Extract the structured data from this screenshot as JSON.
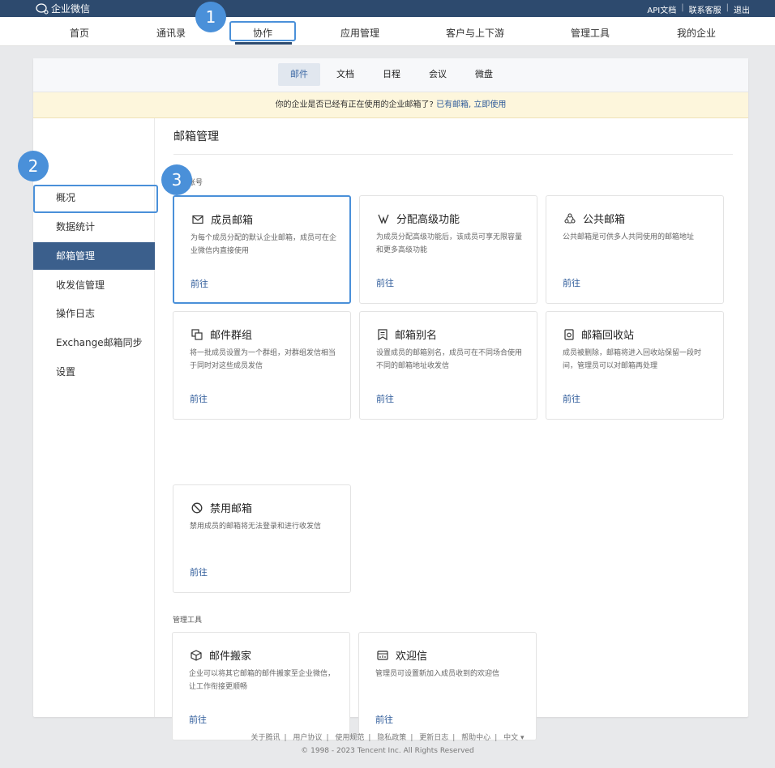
{
  "topbar": {
    "logo_text": "企业微信",
    "links": [
      "API文档",
      "联系客服",
      "退出"
    ]
  },
  "mainnav": {
    "items": [
      "首页",
      "通讯录",
      "协作",
      "应用管理",
      "客户与上下游",
      "管理工具",
      "我的企业"
    ],
    "active": "协作"
  },
  "badges": [
    "1",
    "2",
    "3"
  ],
  "subnav": {
    "tabs": [
      "邮件",
      "文档",
      "日程",
      "会议",
      "微盘"
    ],
    "active": "邮件"
  },
  "notice": {
    "text": "你的企业是否已经有正在使用的企业邮箱了?",
    "link": "已有邮箱, 立即使用"
  },
  "sidebar": {
    "items": [
      "概况",
      "数据统计",
      "邮箱管理",
      "收发信管理",
      "操作日志",
      "Exchange邮箱同步",
      "设置"
    ],
    "active": "邮箱管理"
  },
  "content": {
    "title": "邮箱管理",
    "section1_label": "账号",
    "section2_label": "管理工具",
    "go_label": "前往",
    "cards": [
      {
        "title": "成员邮箱",
        "desc": "为每个成员分配的默认企业邮箱，成员可在企业微信内直接使用",
        "icon": "mail-icon"
      },
      {
        "title": "分配高级功能",
        "desc": "为成员分配高级功能后，该成员可享无限容量和更多高级功能",
        "icon": "vip-icon"
      },
      {
        "title": "公共邮箱",
        "desc": "公共邮箱是可供多人共同使用的邮箱地址",
        "icon": "shared-icon"
      },
      {
        "title": "邮件群组",
        "desc": "将一批成员设置为一个群组，对群组发信相当于同时对这些成员发信",
        "icon": "group-icon"
      },
      {
        "title": "邮箱别名",
        "desc": "设置成员的邮箱别名，成员可在不同场合使用不同的邮箱地址收发信",
        "icon": "alias-icon"
      },
      {
        "title": "邮箱回收站",
        "desc": "成员被删除，邮箱将进入回收站保留一段时间，管理员可以对邮箱再处理",
        "icon": "recycle-icon"
      },
      {
        "title": "禁用邮箱",
        "desc": "禁用成员的邮箱将无法登录和进行收发信",
        "icon": "ban-icon"
      },
      {
        "title": "邮件搬家",
        "desc": "企业可以将其它邮箱的邮件搬家至企业微信，让工作衔接更顺畅",
        "icon": "box-icon"
      },
      {
        "title": "欢迎信",
        "desc": "管理员可设置新加入成员收到的欢迎信",
        "icon": "welcome-icon"
      }
    ]
  },
  "footer": {
    "links": [
      "关于腾讯",
      "用户协议",
      "使用规范",
      "隐私政策",
      "更新日志",
      "帮助中心",
      "中文 ▾"
    ],
    "copyright": "© 1998 - 2023 Tencent Inc. All Rights Reserved"
  },
  "colors": {
    "primary": "#2d4a6e",
    "highlight": "#4a90d9",
    "link": "#2e5b9a",
    "notice_bg": "#fdf6dc"
  }
}
